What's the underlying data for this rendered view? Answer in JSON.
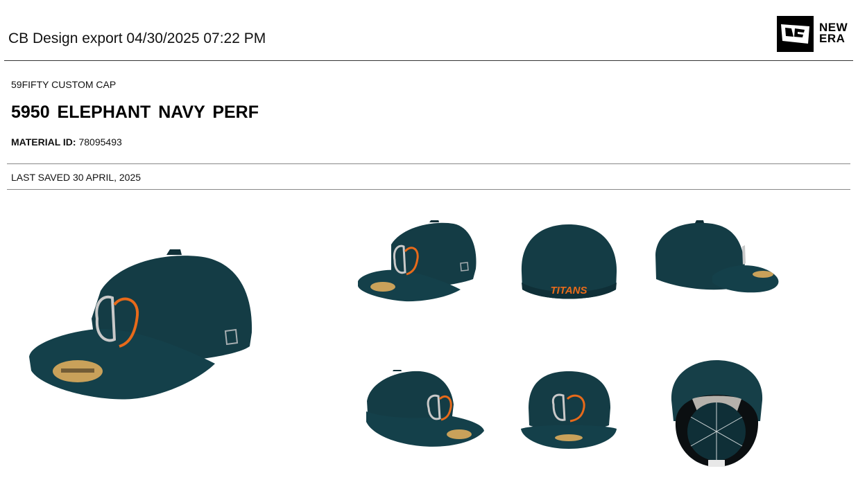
{
  "header": {
    "title": "CB Design export 04/30/2025 07:22 PM"
  },
  "brand": {
    "logo_text_line1": "NEW",
    "logo_text_line2": "ERA",
    "logo_alt": "new-era-flag-logo"
  },
  "product": {
    "category": "59FIFTY CUSTOM CAP",
    "name": "5950  ELEPHANT NAVY  PERF",
    "material_label": "MATERIAL ID:",
    "material_id": "78095493",
    "last_saved": "LAST SAVED 30 APRIL, 2025"
  },
  "views": {
    "back_text": "TITANS"
  },
  "colors": {
    "cap": "#143c45",
    "cap_dark": "#0f2f37",
    "logo_orange": "#e86a1a",
    "logo_gray": "#c9c9c9",
    "sticker": "#c9a15a"
  }
}
